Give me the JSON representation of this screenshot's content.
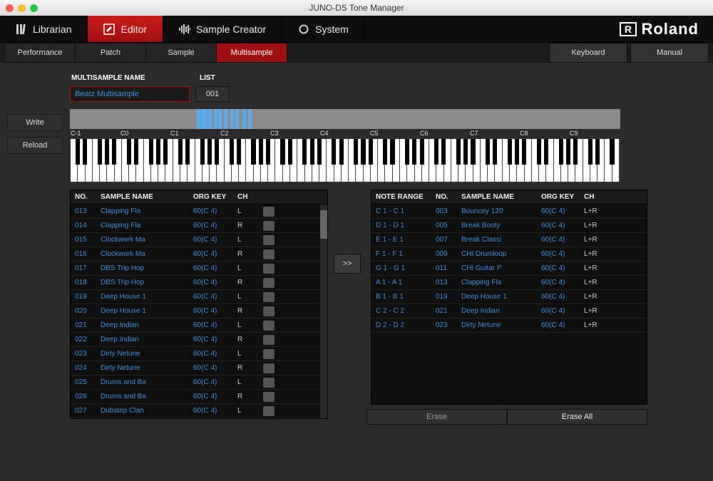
{
  "window": {
    "title": "JUNO-DS Tone Manager"
  },
  "brand": {
    "name": "Roland"
  },
  "menubar": {
    "items": [
      {
        "label": "Librarian",
        "icon": "librarian-icon"
      },
      {
        "label": "Editor",
        "icon": "editor-icon",
        "active": true
      },
      {
        "label": "Sample Creator",
        "icon": "sample-creator-icon"
      },
      {
        "label": "System",
        "icon": "system-icon"
      }
    ]
  },
  "subtabs": {
    "items": [
      "Performance",
      "Patch",
      "Sample",
      "Multisample"
    ],
    "active": "Multisample",
    "right": [
      "Keyboard",
      "Manual"
    ]
  },
  "sidebar": {
    "write": "Write",
    "reload": "Reload"
  },
  "form": {
    "name_label": "MULTISAMPLE NAME",
    "list_label": "LIST",
    "name_value": "Beatz Multisample",
    "list_value": "001"
  },
  "octaves": [
    "C-1",
    "C0",
    "C1",
    "C2",
    "C3",
    "C4",
    "C5",
    "C6",
    "C7",
    "C8",
    "C9"
  ],
  "left_table": {
    "headers": {
      "no": "NO.",
      "name": "SAMPLE NAME",
      "org": "ORG KEY",
      "ch": "CH"
    },
    "rows": [
      {
        "no": "013",
        "name": "Clapping Fla",
        "org": "60(C 4)",
        "ch": "L"
      },
      {
        "no": "014",
        "name": "Clapping Fla",
        "org": "60(C 4)",
        "ch": "R"
      },
      {
        "no": "015",
        "name": "Clockwork Ma",
        "org": "60(C 4)",
        "ch": "L"
      },
      {
        "no": "016",
        "name": "Clockwork Ma",
        "org": "60(C 4)",
        "ch": "R"
      },
      {
        "no": "017",
        "name": "DBS Trip Hop",
        "org": "60(C 4)",
        "ch": "L"
      },
      {
        "no": "018",
        "name": "DBS Trip Hop",
        "org": "60(C 4)",
        "ch": "R"
      },
      {
        "no": "019",
        "name": "Deep House 1",
        "org": "60(C 4)",
        "ch": "L"
      },
      {
        "no": "020",
        "name": "Deep House 1",
        "org": "60(C 4)",
        "ch": "R"
      },
      {
        "no": "021",
        "name": "Deep Indian",
        "org": "60(C 4)",
        "ch": "L"
      },
      {
        "no": "022",
        "name": "Deep Indian",
        "org": "60(C 4)",
        "ch": "R"
      },
      {
        "no": "023",
        "name": "Dirty Netune",
        "org": "60(C 4)",
        "ch": "L"
      },
      {
        "no": "024",
        "name": "Dirty Netune",
        "org": "60(C 4)",
        "ch": "R"
      },
      {
        "no": "025",
        "name": "Drums and Ba",
        "org": "60(C 4)",
        "ch": "L"
      },
      {
        "no": "026",
        "name": "Drums and Ba",
        "org": "60(C 4)",
        "ch": "R"
      },
      {
        "no": "027",
        "name": "Dubstep Clan",
        "org": "60(C 4)",
        "ch": "L"
      }
    ]
  },
  "right_table": {
    "headers": {
      "range": "NOTE RANGE",
      "no": "NO.",
      "name": "SAMPLE NAME",
      "org": "ORG KEY",
      "ch": "CH"
    },
    "rows": [
      {
        "range": "C 1 - C 1",
        "no": "003",
        "name": "Bouncey 120",
        "org": "60(C 4)",
        "ch": "L+R"
      },
      {
        "range": "D 1 - D 1",
        "no": "005",
        "name": "Break Booty",
        "org": "60(C 4)",
        "ch": "L+R"
      },
      {
        "range": "E 1 - E 1",
        "no": "007",
        "name": "Break Classi",
        "org": "60(C 4)",
        "ch": "L+R"
      },
      {
        "range": "F 1 - F 1",
        "no": "009",
        "name": "CHI Drumloop",
        "org": "60(C 4)",
        "ch": "L+R"
      },
      {
        "range": "G 1 - G 1",
        "no": "011",
        "name": "CHI Guitar P",
        "org": "60(C 4)",
        "ch": "L+R"
      },
      {
        "range": "A 1 - A 1",
        "no": "013",
        "name": "Clapping Fla",
        "org": "60(C 4)",
        "ch": "L+R"
      },
      {
        "range": "B 1 - B 1",
        "no": "019",
        "name": "Deep House 1",
        "org": "60(C 4)",
        "ch": "L+R"
      },
      {
        "range": "C 2 - C 2",
        "no": "021",
        "name": "Deep Indian",
        "org": "60(C 4)",
        "ch": "L+R"
      },
      {
        "range": "D 2 - D 2",
        "no": "023",
        "name": "Dirty Netune",
        "org": "60(C 4)",
        "ch": "L+R"
      }
    ]
  },
  "buttons": {
    "move": ">>",
    "erase": "Erase",
    "erase_all": "Erase All"
  },
  "keymap_bars": [
    178,
    184,
    188,
    194,
    202,
    208,
    216,
    225,
    232,
    242,
    250
  ]
}
